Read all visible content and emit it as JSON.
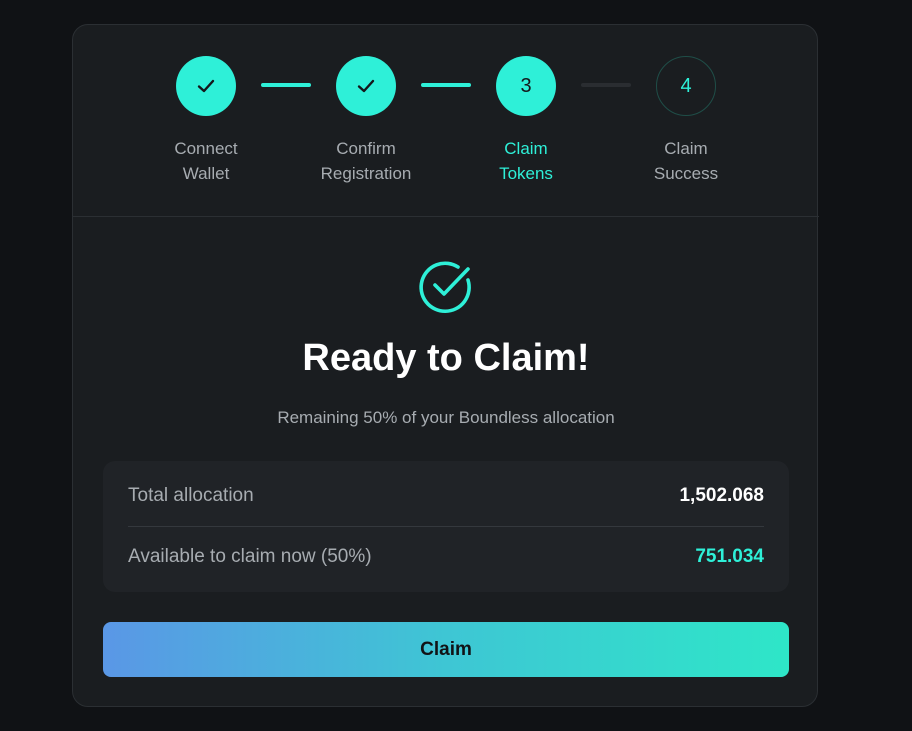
{
  "steps": [
    {
      "number": "1",
      "label_line1": "Connect",
      "label_line2": "Wallet",
      "status": "done"
    },
    {
      "number": "2",
      "label_line1": "Confirm",
      "label_line2": "Registration",
      "status": "done"
    },
    {
      "number": "3",
      "label_line1": "Claim",
      "label_line2": "Tokens",
      "status": "active"
    },
    {
      "number": "4",
      "label_line1": "Claim",
      "label_line2": "Success",
      "status": "pending"
    }
  ],
  "hero": {
    "icon": "check-circle-icon",
    "title": "Ready to Claim!",
    "subtitle": "Remaining 50% of your Boundless allocation"
  },
  "allocation": {
    "total_label": "Total allocation",
    "total_value": "1,502.068",
    "available_label": "Available to claim now (50%)",
    "available_value": "751.034"
  },
  "claim_button": {
    "label": "Claim"
  },
  "colors": {
    "accent": "#2ef0d8",
    "background": "#101215",
    "card": "#1a1d20",
    "button_gradient_start": "#5a97e6",
    "button_gradient_end": "#2ee6c8"
  }
}
